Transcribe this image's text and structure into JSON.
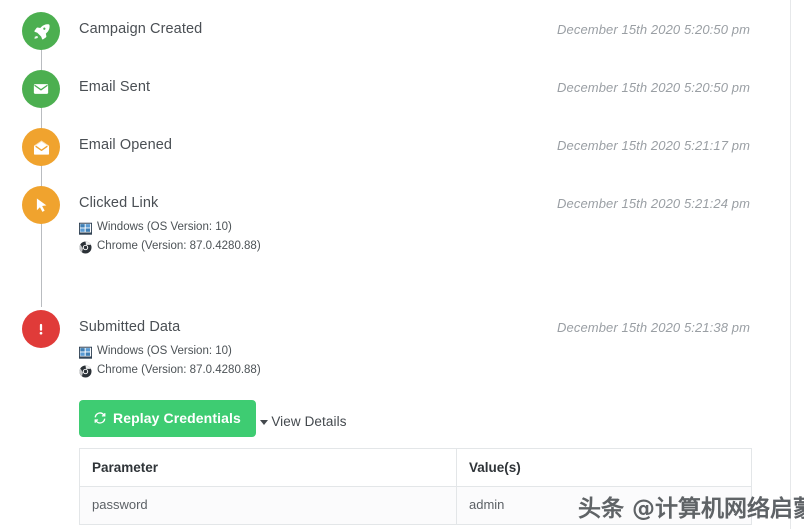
{
  "colors": {
    "green": "#4caf50",
    "orange": "#f0a32e",
    "red": "#e03b39",
    "button_green": "#3ecc72",
    "timeline_line": "#b9bcc0",
    "timestamp_text": "#9a9fa4"
  },
  "timeline": {
    "events": [
      {
        "icon": "rocket-icon",
        "color_key": "green",
        "title": "Campaign Created",
        "timestamp": "December 15th 2020 5:20:50 pm",
        "meta": []
      },
      {
        "icon": "envelope-closed-icon",
        "color_key": "green",
        "title": "Email Sent",
        "timestamp": "December 15th 2020 5:20:50 pm",
        "meta": []
      },
      {
        "icon": "envelope-open-icon",
        "color_key": "orange",
        "title": "Email Opened",
        "timestamp": "December 15th 2020 5:21:17 pm",
        "meta": []
      },
      {
        "icon": "cursor-click-icon",
        "color_key": "orange",
        "title": "Clicked Link",
        "timestamp": "December 15th 2020 5:21:24 pm",
        "meta": [
          {
            "icon": "windows-icon",
            "text": "Windows (OS Version: 10)"
          },
          {
            "icon": "chrome-icon",
            "text": "Chrome (Version: 87.0.4280.88)"
          }
        ]
      },
      {
        "icon": "exclamation-icon",
        "color_key": "red",
        "title": "Submitted Data",
        "timestamp": "December 15th 2020 5:21:38 pm",
        "meta": [
          {
            "icon": "windows-icon",
            "text": "Windows (OS Version: 10)"
          },
          {
            "icon": "chrome-icon",
            "text": "Chrome (Version: 87.0.4280.88)"
          }
        ]
      }
    ]
  },
  "submitted_details": {
    "replay_button_label": "Replay Credentials",
    "replay_button_icon": "refresh-icon",
    "view_details_label": "View Details",
    "view_details_icon": "caret-down-icon",
    "table": {
      "columns": [
        "Parameter",
        "Value(s)"
      ],
      "rows": [
        [
          "password",
          "admin"
        ]
      ]
    }
  },
  "watermark": {
    "text": "头条 @计算机网络启蒙"
  }
}
